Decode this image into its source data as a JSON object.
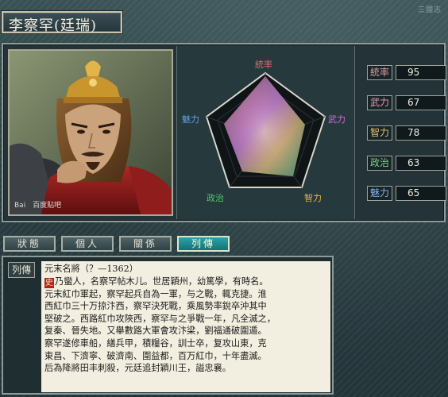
{
  "header": {
    "title": "李察罕(廷瑞)",
    "watermark": "三國志"
  },
  "portrait": {
    "label": "Bai",
    "label2": "百度贴吧"
  },
  "radar": {
    "labels": {
      "top": "統率",
      "right": "武力",
      "bottom_right": "智力",
      "bottom_left": "政治",
      "left": "魅力"
    },
    "colors": {
      "top": "#e26b6b",
      "right": "#d06ad0",
      "bottom_right": "#e0b63a",
      "bottom_left": "#55c46a",
      "left": "#5fa4e6"
    }
  },
  "stats": [
    {
      "label": "統率",
      "value": "95",
      "color": "#e29aa0"
    },
    {
      "label": "武力",
      "value": "67",
      "color": "#e79ab6"
    },
    {
      "label": "智力",
      "value": "78",
      "color": "#e2c36a"
    },
    {
      "label": "政治",
      "value": "63",
      "color": "#7fd18d"
    },
    {
      "label": "魅力",
      "value": "65",
      "color": "#7fb6e8"
    }
  ],
  "tabs": [
    {
      "label": "狀態",
      "active": false
    },
    {
      "label": "個人",
      "active": false
    },
    {
      "label": "關係",
      "active": false
    },
    {
      "label": "列傳",
      "active": true
    }
  ],
  "bio": {
    "tag": "列傳",
    "heading": "元末名將（？—1362）",
    "icon": "史",
    "lines": [
      "乃蠻人，名察罕帖木儿。世居穎州，幼篤學，有時名。",
      "元末紅巾軍起，察罕起兵自為一軍，与之戰，輒克捷。淮",
      "西紅巾三十万掠汴西，察罕決死戰，乘風勢率銳卒沖其中",
      "堅破之。西路紅巾攻陝西，察罕与之爭戰一年，凡全滅之，",
      "复秦、晉失地。又舉數路大軍會攻汴梁，劉福通破圍遁。",
      "察罕遂修車船，繕兵甲，積糧谷，訓士卒，复攻山東，克",
      "東昌、下濟寧、破濟南、圍益都，百万紅巾，十年盡滅。",
      "后為降將田丰刺殺，元廷追封穎川王，謚忠襄。"
    ]
  }
}
